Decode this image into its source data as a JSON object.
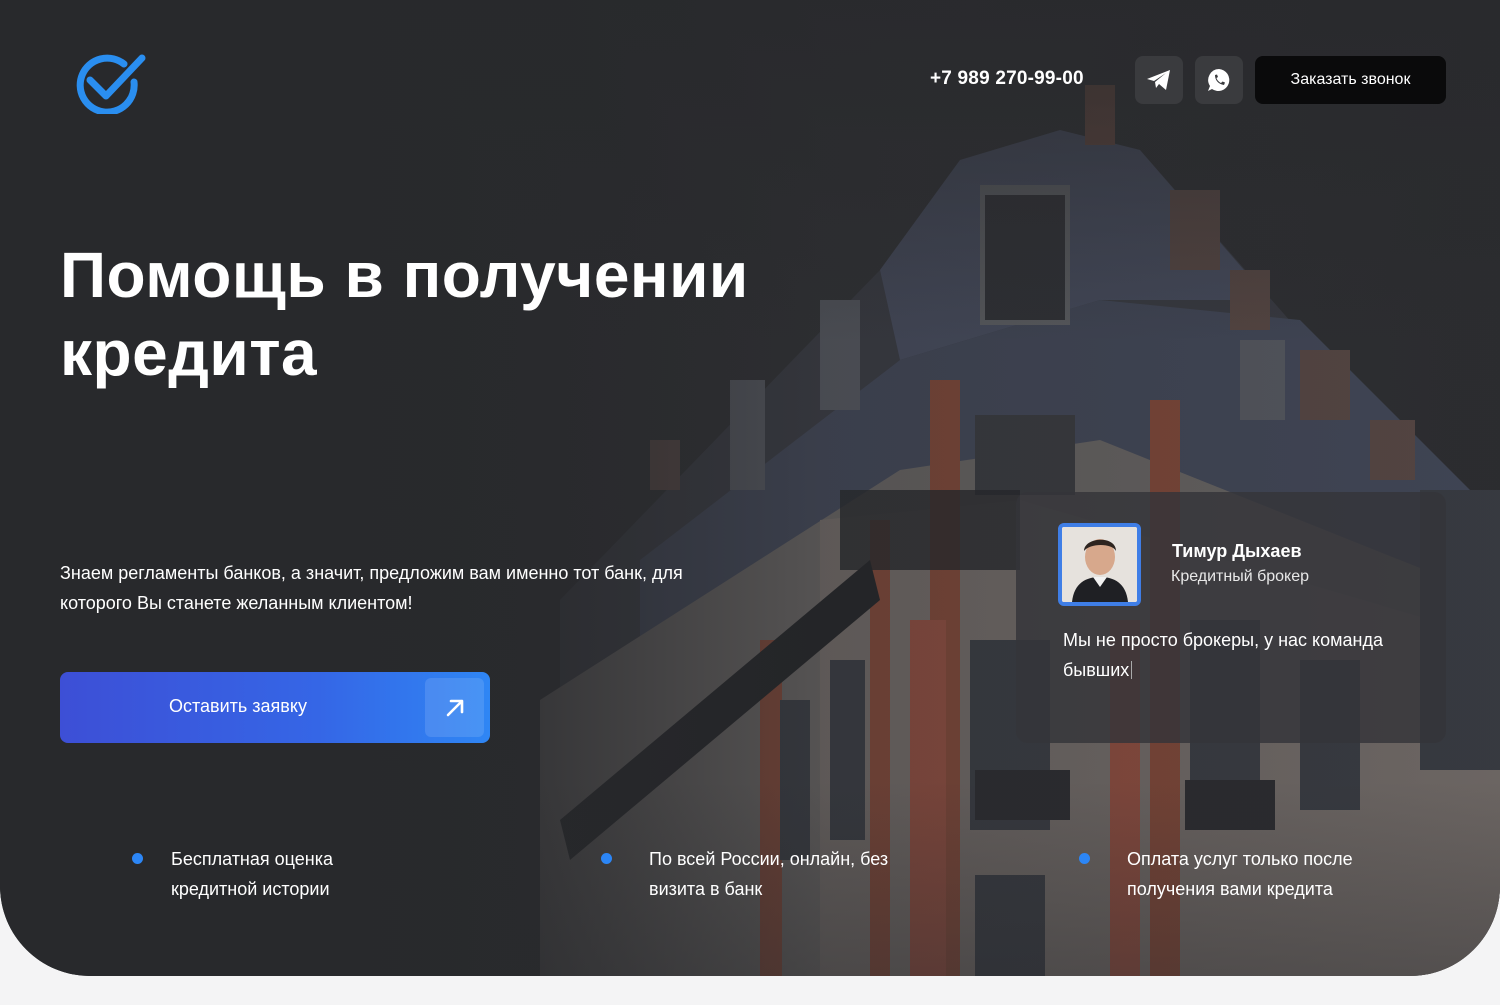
{
  "header": {
    "phone": "+7 989 270-99-00",
    "call_label": "Заказать звонок"
  },
  "hero": {
    "title": "Помощь в получении кредита",
    "subtitle": "Знаем регламенты банков, а значит, предложим вам именно тот банк, для которого Вы станете желанным клиентом!",
    "cta_label": "Оставить заявку"
  },
  "broker_card": {
    "name": "Тимур Дыхаев",
    "role": "Кредитный брокер",
    "quote": "Мы не просто брокеры, у нас команда бывших"
  },
  "features": [
    {
      "text": "Бесплатная оценка кредитной истории"
    },
    {
      "text": "По всей России, онлайн, без визита в банк"
    },
    {
      "text": "Оплата услуг только после получения вами кредита"
    }
  ],
  "colors": {
    "accent": "#2c86f6",
    "logo": "#2a8ef0",
    "cta_start": "#3d4fd6",
    "cta_end": "#2f86f4",
    "background": "#2d2e31"
  },
  "icons": [
    "checkmark-logo-icon",
    "telegram-icon",
    "whatsapp-icon",
    "arrow-up-right-icon"
  ]
}
